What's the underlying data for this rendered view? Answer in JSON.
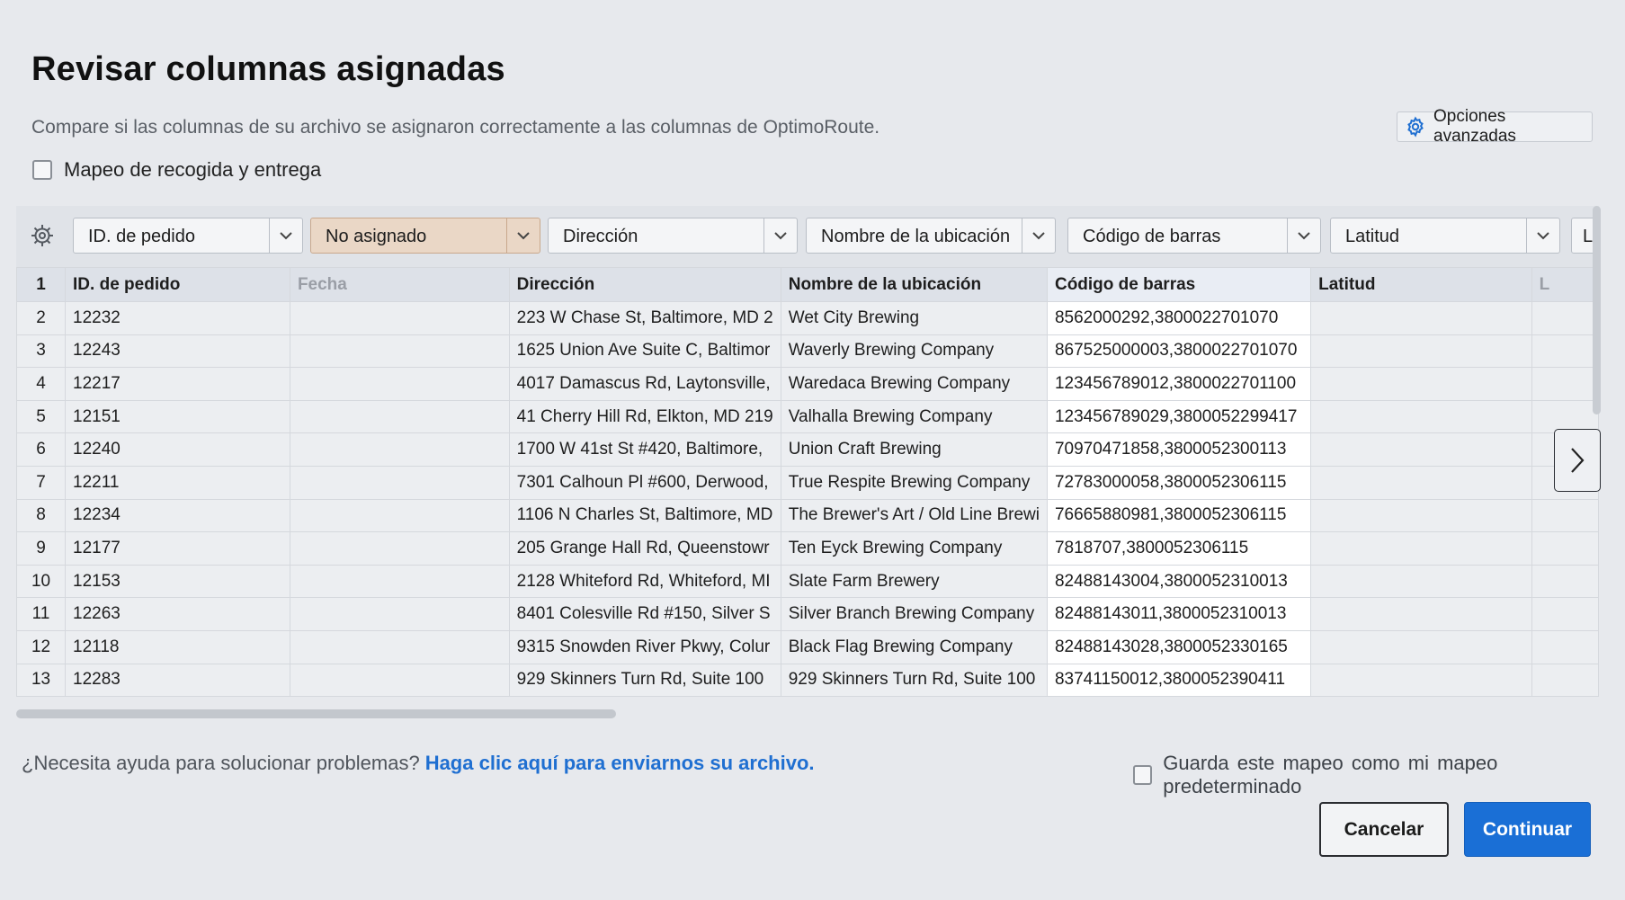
{
  "title": "Revisar columnas asignadas",
  "subtitle": "Compare si las columnas de su archivo se asignaron correctamente a las columnas de OptimoRoute.",
  "advanced_button": {
    "label": "Opciones avanzadas",
    "icon": "gear-icon"
  },
  "pickup_delivery": {
    "label": "Mapeo de recogida y entrega",
    "checked": false
  },
  "mapping": [
    {
      "label": "ID. de pedido",
      "unassigned": false
    },
    {
      "label": "No asignado",
      "unassigned": true
    },
    {
      "label": "Dirección",
      "unassigned": false
    },
    {
      "label": "Nombre de la ubicación",
      "unassigned": false
    },
    {
      "label": "Código de barras",
      "unassigned": false
    },
    {
      "label": "Latitud",
      "unassigned": false
    },
    {
      "label": "L",
      "unassigned": false
    }
  ],
  "table": {
    "header_row_number": "1",
    "headers": [
      "ID. de pedido",
      "Fecha",
      "Dirección",
      "Nombre de la ubicación",
      "Código de barras",
      "Latitud",
      "L"
    ],
    "rows": [
      [
        "2",
        "12232",
        "",
        "223 W Chase St, Baltimore, MD 2",
        "Wet City Brewing",
        "8562000292,3800022701070",
        ""
      ],
      [
        "3",
        "12243",
        "",
        "1625 Union Ave Suite C, Baltimor",
        "Waverly Brewing Company",
        "867525000003,3800022701070",
        ""
      ],
      [
        "4",
        "12217",
        "",
        "4017 Damascus Rd, Laytonsville,",
        "Waredaca Brewing Company",
        "123456789012,3800022701100",
        ""
      ],
      [
        "5",
        "12151",
        "",
        "41 Cherry Hill Rd, Elkton, MD 219",
        "Valhalla Brewing Company",
        "123456789029,3800052299417",
        ""
      ],
      [
        "6",
        "12240",
        "",
        "1700 W 41st St #420, Baltimore, ",
        "Union Craft Brewing",
        "70970471858,3800052300113",
        ""
      ],
      [
        "7",
        "12211",
        "",
        "7301 Calhoun Pl #600, Derwood,",
        "True Respite Brewing Company",
        "72783000058,3800052306115",
        ""
      ],
      [
        "8",
        "12234",
        "",
        "1106 N Charles St, Baltimore, MD",
        "The Brewer's Art / Old Line Brewi",
        "76665880981,3800052306115",
        ""
      ],
      [
        "9",
        "12177",
        "",
        "205 Grange Hall Rd, Queenstowr",
        "Ten Eyck Brewing Company",
        "7818707,3800052306115",
        ""
      ],
      [
        "10",
        "12153",
        "",
        "2128 Whiteford Rd, Whiteford, MI",
        "Slate Farm Brewery",
        "82488143004,3800052310013",
        ""
      ],
      [
        "11",
        "12263",
        "",
        "8401 Colesville Rd #150, Silver S",
        "Silver Branch Brewing Company",
        "82488143011,3800052310013",
        ""
      ],
      [
        "12",
        "12118",
        "",
        "9315 Snowden River Pkwy, Colur",
        "Black Flag Brewing Company",
        "82488143028,3800052330165",
        ""
      ],
      [
        "13",
        "12283",
        "",
        "929 Skinners Turn Rd, Suite 100",
        "929 Skinners Turn Rd, Suite 100",
        "83741150012,3800052390411",
        ""
      ]
    ]
  },
  "footer": {
    "help_text": "¿Necesita ayuda para solucionar problemas?",
    "help_link": "Haga clic aquí para enviarnos su archivo.",
    "save_default_label": "Guarda este mapeo como mi mapeo predeterminado",
    "save_default_checked": false,
    "cancel_label": "Cancelar",
    "continue_label": "Continuar"
  },
  "colors": {
    "primary": "#1a6fd6",
    "link": "#1f6fd1",
    "unassigned_bg": "#ead7c6"
  }
}
